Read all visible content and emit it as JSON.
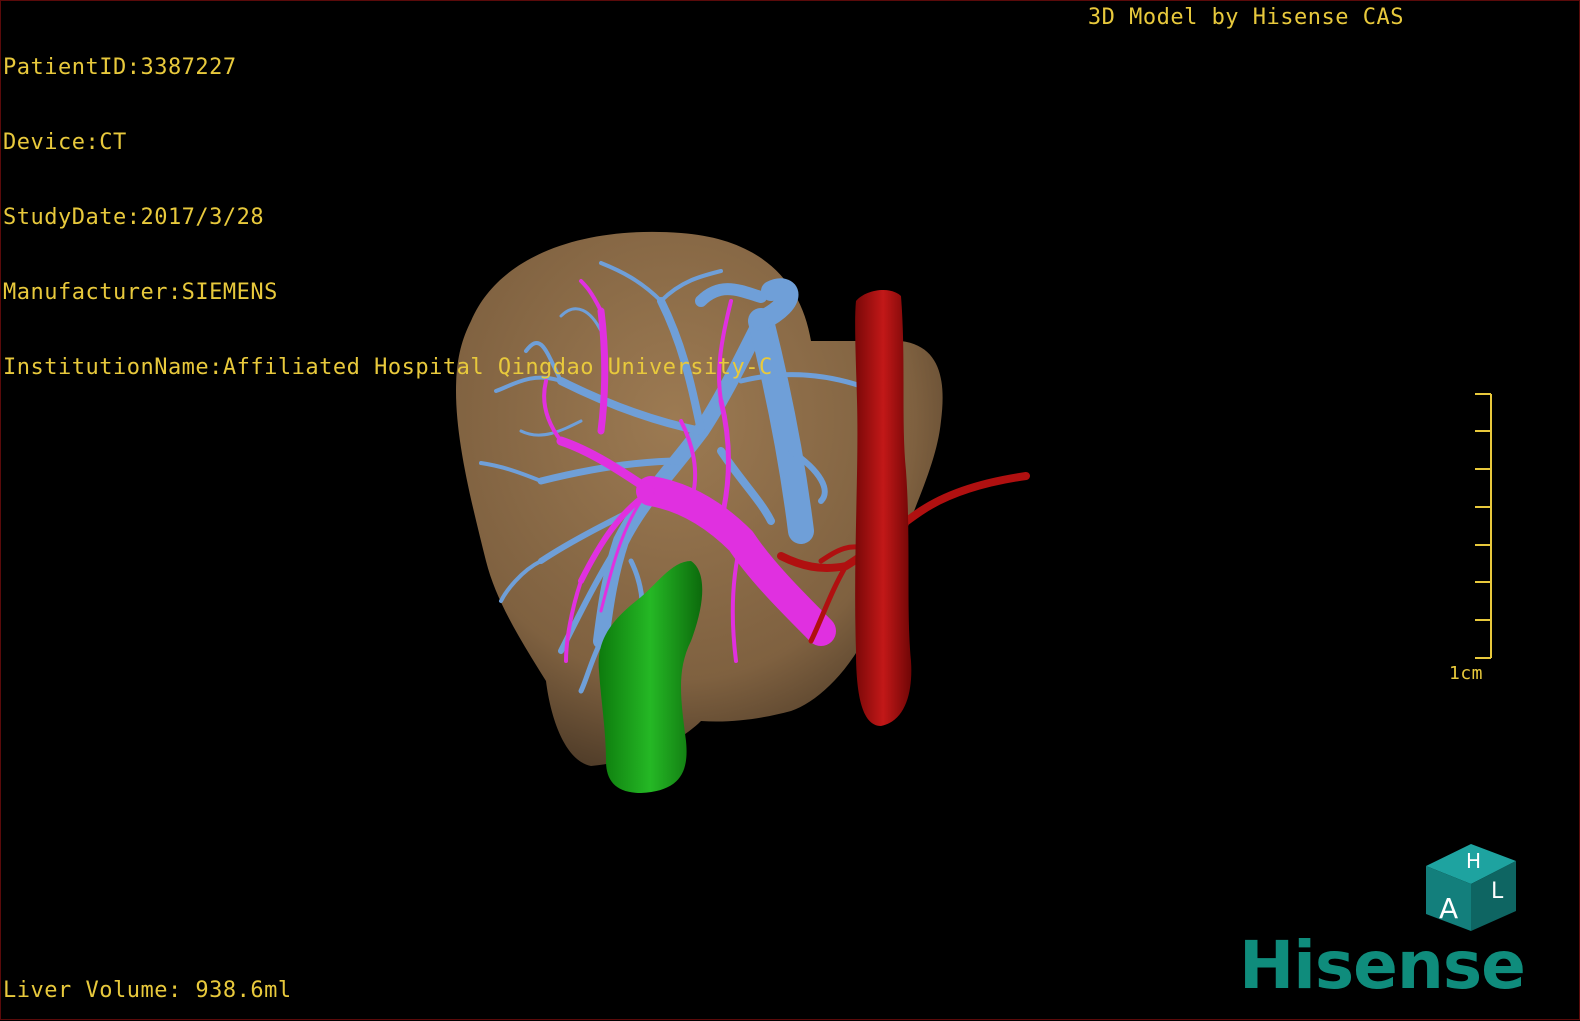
{
  "header": {
    "patient_id": "PatientID:3387227",
    "device": "Device:CT",
    "study_date": "StudyDate:2017/3/28",
    "manufacturer": "Manufacturer:SIEMENS",
    "institution": "InstitutionName:Affiliated Hospital Qingdao University-C"
  },
  "brand_text": "3D Model by Hisense CAS",
  "footer": {
    "liver_volume": "Liver Volume: 938.6ml"
  },
  "scale_bar": {
    "label": "1cm"
  },
  "orientation_cube": {
    "top_label": "H",
    "front_label": "A",
    "side_label": "L"
  },
  "logo": {
    "text": "Hisense"
  },
  "colors": {
    "overlay_text": "#e8c93c",
    "liver": "#8a6a45",
    "hepatic_vein": "#6f9fd8",
    "portal_vein": "#e030e0",
    "hepatic_artery": "#b01010",
    "gallbladder_duct": "#1faa1f",
    "logo": "#0f8c7c"
  },
  "model_structures": [
    "liver",
    "hepatic-vein",
    "portal-vein",
    "hepatic-artery",
    "inferior-vena-cava",
    "bile-duct"
  ]
}
